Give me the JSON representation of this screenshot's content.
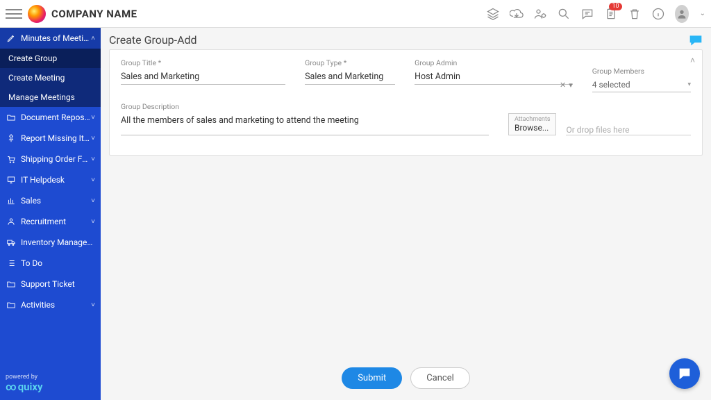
{
  "header": {
    "company": "COMPANY NAME",
    "notification_count": "10"
  },
  "sidebar": {
    "items": [
      {
        "icon": "pencil",
        "label": "Minutes of Meeting",
        "expanded": true,
        "children": [
          {
            "label": "Create Group",
            "selected": true
          },
          {
            "label": "Create Meeting"
          },
          {
            "label": "Manage Meetings"
          }
        ]
      },
      {
        "icon": "folder",
        "label": "Document Repository",
        "chev": "›"
      },
      {
        "icon": "pin",
        "label": "Report Missing Items",
        "chev": "›"
      },
      {
        "icon": "cart",
        "label": "Shipping Order Form",
        "chev": "˅"
      },
      {
        "icon": "monitor",
        "label": "IT Helpdesk",
        "chev": "˅"
      },
      {
        "icon": "chart",
        "label": "Sales",
        "chev": "˅"
      },
      {
        "icon": "person",
        "label": "Recruitment",
        "chev": "˅"
      },
      {
        "icon": "truck",
        "label": "Inventory Management"
      },
      {
        "icon": "list",
        "label": "To Do"
      },
      {
        "icon": "folder",
        "label": "Support Ticket"
      },
      {
        "icon": "folder",
        "label": "Activities",
        "chev": "˅"
      }
    ],
    "powered_label": "powered by",
    "powered_brand": "quixy"
  },
  "page": {
    "title": "Create Group-Add",
    "form": {
      "group_title_label": "Group Title *",
      "group_title_value": "Sales and Marketing",
      "group_type_label": "Group Type *",
      "group_type_value": "Sales and Marketing",
      "group_admin_label": "Group Admin",
      "group_admin_value": "Host Admin",
      "group_members_label": "Group Members",
      "group_members_value": "4 selected",
      "group_desc_label": "Group Description",
      "group_desc_value": "All the members of sales and marketing to attend the meeting",
      "attachments_label": "Attachments",
      "browse_label": "Browse...",
      "drop_hint": "Or drop files here"
    },
    "actions": {
      "submit": "Submit",
      "cancel": "Cancel"
    }
  }
}
